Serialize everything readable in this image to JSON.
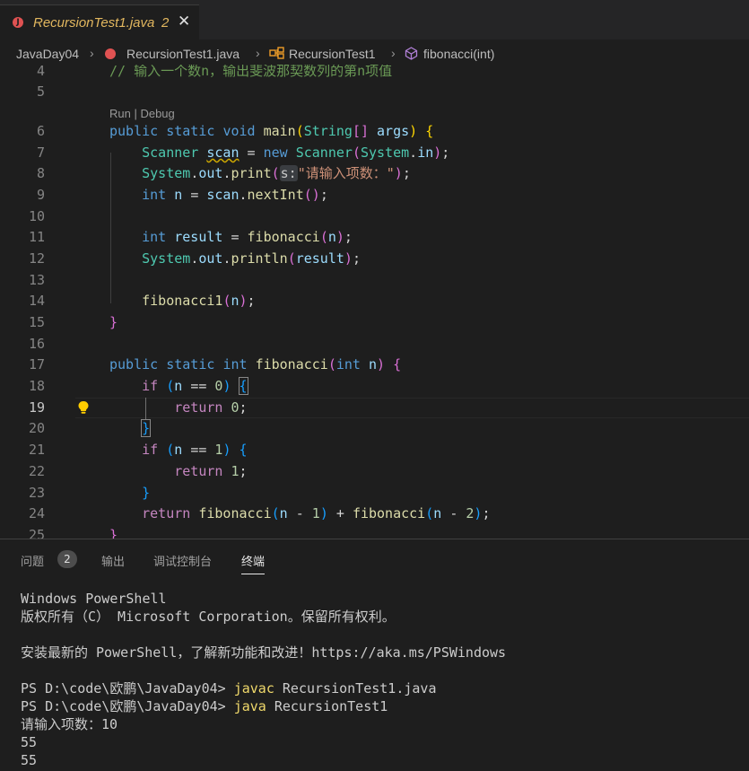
{
  "tab": {
    "title": "RecursionTest1.java",
    "badge": "2",
    "close": "✕"
  },
  "breadcrumb": {
    "project": "JavaDay04",
    "file": "RecursionTest1.java",
    "class": "RecursionTest1",
    "method": "fibonacci(int)"
  },
  "editor": {
    "comment": "// 输入一个数n，输出斐波那契数列的第n项值",
    "codelens": "Run | Debug",
    "line_numbers": [
      "4",
      "5",
      "6",
      "7",
      "8",
      "9",
      "10",
      "11",
      "12",
      "13",
      "14",
      "15",
      "16",
      "17",
      "18",
      "19",
      "20",
      "21",
      "22",
      "23",
      "24",
      "25"
    ],
    "param_hint": "s:",
    "prompt_string": "\"请输入项数：\"",
    "active_line": "19"
  },
  "panel": {
    "tabs": [
      "问题",
      "输出",
      "调试控制台",
      "终端"
    ],
    "problems_count": "2",
    "active_tab": "终端"
  },
  "terminal": {
    "lines": [
      "Windows PowerShell",
      "版权所有（C） Microsoft Corporation。保留所有权利。",
      "",
      "安装最新的 PowerShell，了解新功能和改进！https://aka.ms/PSWindows",
      ""
    ],
    "prompt": "PS D:\\code\\欧鹏\\JavaDay04>",
    "cmd1_name": "javac",
    "cmd1_arg": "RecursionTest1.java",
    "cmd2_name": "java",
    "cmd2_arg": "RecursionTest1",
    "output1": "请输入项数：10",
    "output2": "55",
    "output3": "55"
  }
}
